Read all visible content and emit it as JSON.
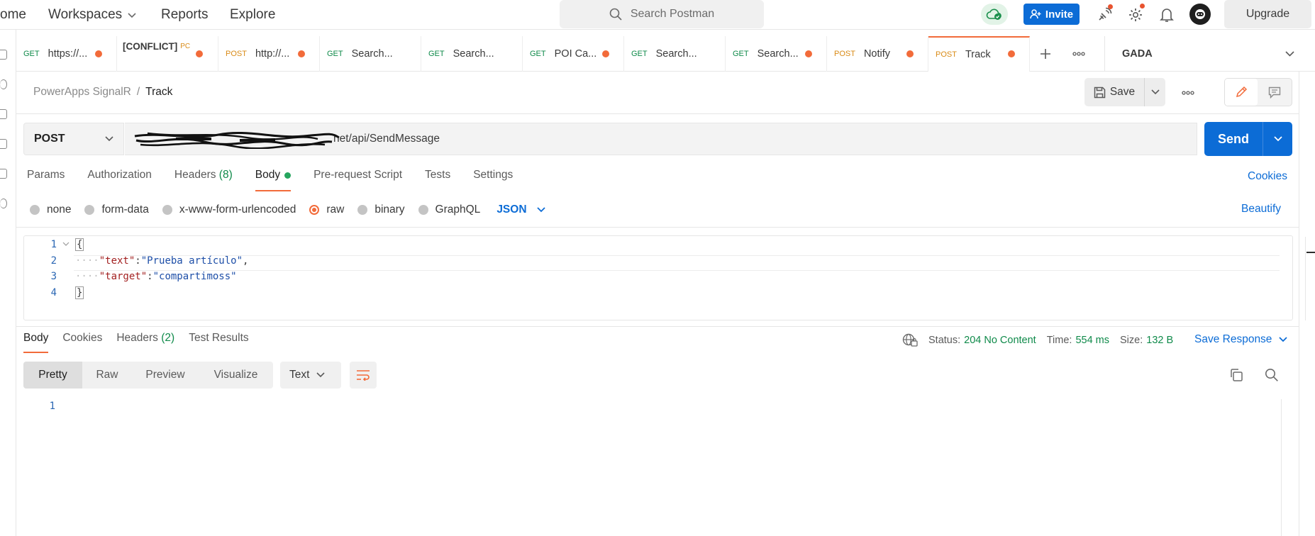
{
  "topbar": {
    "home_label": "ome",
    "workspaces_label": "Workspaces",
    "reports_label": "Reports",
    "explore_label": "Explore",
    "search_placeholder": "Search Postman",
    "invite_label": "Invite",
    "upgrade_label": "Upgrade"
  },
  "tabs": [
    {
      "method": "GET",
      "title": "https://...",
      "dirty": true
    },
    {
      "method": "",
      "title": "[CONFLICT]",
      "suffix": "PC",
      "dirty": true
    },
    {
      "method": "POST",
      "title": "http://...",
      "dirty": true
    },
    {
      "method": "GET",
      "title": "Search...",
      "dirty": false
    },
    {
      "method": "GET",
      "title": "Search...",
      "dirty": false
    },
    {
      "method": "GET",
      "title": "POI Ca...",
      "dirty": true
    },
    {
      "method": "GET",
      "title": "Search...",
      "dirty": false
    },
    {
      "method": "GET",
      "title": "Search...",
      "dirty": true
    },
    {
      "method": "POST",
      "title": "Notify",
      "dirty": true
    },
    {
      "method": "POST",
      "title": "Track",
      "dirty": true,
      "active": true
    }
  ],
  "environment": "GADA",
  "breadcrumb": {
    "parent": "PowerApps SignalR",
    "separator": "/",
    "current": "Track"
  },
  "toolbar": {
    "save_label": "Save"
  },
  "request": {
    "method": "POST",
    "url": "https://[redacted].azurewebsites.net/api/SendMessage",
    "url_visible": "net/api/SendMessage",
    "send_label": "Send"
  },
  "request_tabs": {
    "params": "Params",
    "authorization": "Authorization",
    "headers": "Headers",
    "headers_count": "(8)",
    "body": "Body",
    "prerequest": "Pre-request Script",
    "tests": "Tests",
    "settings": "Settings",
    "cookies": "Cookies"
  },
  "body_types": {
    "none": "none",
    "form_data": "form-data",
    "urlencoded": "x-www-form-urlencoded",
    "raw": "raw",
    "binary": "binary",
    "graphql": "GraphQL",
    "format": "JSON",
    "beautify": "Beautify",
    "selected": "raw"
  },
  "editor": {
    "lines": [
      {
        "n": "1",
        "text": "{"
      },
      {
        "n": "2",
        "key": "\"text\"",
        "value": "\"Prueba artículo\"",
        "trail": ","
      },
      {
        "n": "3",
        "key": "\"target\"",
        "value": "\"compartimoss\"",
        "trail": ""
      },
      {
        "n": "4",
        "text": "}"
      }
    ]
  },
  "response": {
    "tabs": {
      "body": "Body",
      "cookies": "Cookies",
      "headers": "Headers",
      "headers_count": "(2)",
      "test_results": "Test Results"
    },
    "status_label": "Status:",
    "status_value": "204 No Content",
    "time_label": "Time:",
    "time_value": "554 ms",
    "size_label": "Size:",
    "size_value": "132 B",
    "save_response": "Save Response",
    "views": {
      "pretty": "Pretty",
      "raw": "Raw",
      "preview": "Preview",
      "visualize": "Visualize"
    },
    "format": "Text",
    "line_number": "1"
  },
  "colors": {
    "accent_orange": "#f26b3a",
    "primary_blue": "#0c6cd6",
    "success_green": "#0f8a4a"
  }
}
